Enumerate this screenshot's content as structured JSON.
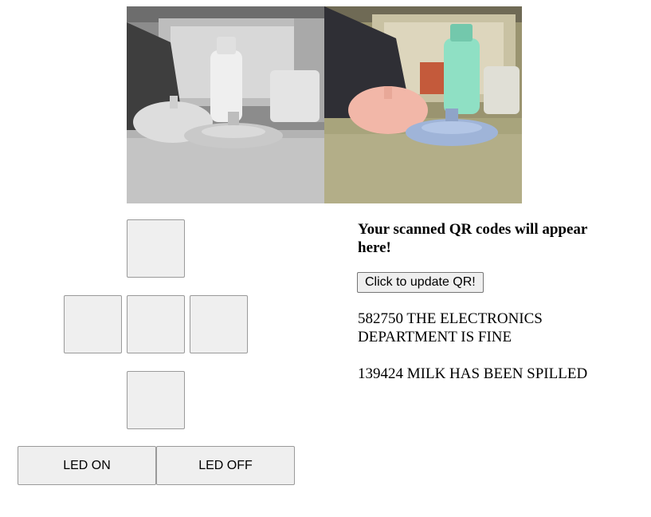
{
  "camera": {
    "left_view": "grayscale",
    "right_view": "color"
  },
  "dpad": {
    "up_label": "",
    "left_label": "",
    "center_label": "",
    "right_label": "",
    "down_label": ""
  },
  "led": {
    "on_label": "LED ON",
    "off_label": "LED OFF"
  },
  "qr": {
    "heading": "Your scanned QR codes will appear here!",
    "update_label": "Click to update QR!",
    "codes": [
      "582750 THE ELECTRONICS DEPARTMENT IS FINE",
      "139424 MILK HAS BEEN SPILLED"
    ]
  },
  "colors": {
    "button_bg": "#efefef",
    "button_border": "#9a9a9a",
    "bottle_color": "#8fe0c4",
    "lid_color": "#f2b7a8",
    "base_color": "#9fb4d8"
  }
}
